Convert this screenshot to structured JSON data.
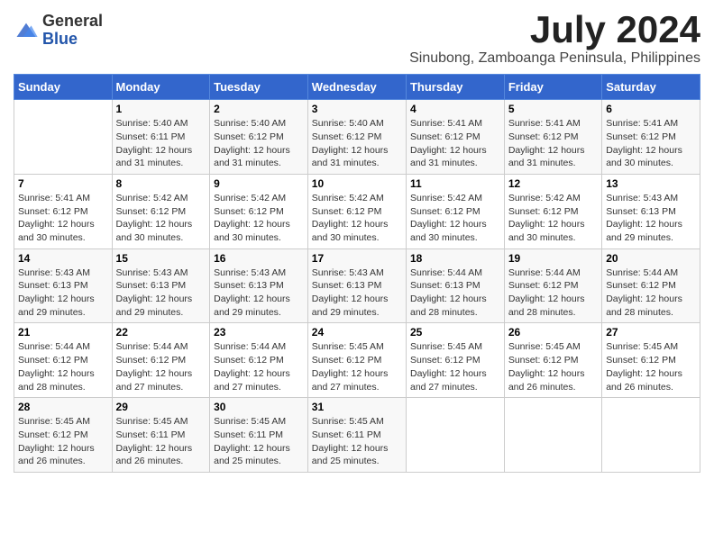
{
  "header": {
    "logo_general": "General",
    "logo_blue": "Blue",
    "month_title": "July 2024",
    "location": "Sinubong, Zamboanga Peninsula, Philippines"
  },
  "days_of_week": [
    "Sunday",
    "Monday",
    "Tuesday",
    "Wednesday",
    "Thursday",
    "Friday",
    "Saturday"
  ],
  "weeks": [
    [
      {
        "day": "",
        "sunrise": "",
        "sunset": "",
        "daylight": ""
      },
      {
        "day": "1",
        "sunrise": "Sunrise: 5:40 AM",
        "sunset": "Sunset: 6:11 PM",
        "daylight": "Daylight: 12 hours and 31 minutes."
      },
      {
        "day": "2",
        "sunrise": "Sunrise: 5:40 AM",
        "sunset": "Sunset: 6:12 PM",
        "daylight": "Daylight: 12 hours and 31 minutes."
      },
      {
        "day": "3",
        "sunrise": "Sunrise: 5:40 AM",
        "sunset": "Sunset: 6:12 PM",
        "daylight": "Daylight: 12 hours and 31 minutes."
      },
      {
        "day": "4",
        "sunrise": "Sunrise: 5:41 AM",
        "sunset": "Sunset: 6:12 PM",
        "daylight": "Daylight: 12 hours and 31 minutes."
      },
      {
        "day": "5",
        "sunrise": "Sunrise: 5:41 AM",
        "sunset": "Sunset: 6:12 PM",
        "daylight": "Daylight: 12 hours and 31 minutes."
      },
      {
        "day": "6",
        "sunrise": "Sunrise: 5:41 AM",
        "sunset": "Sunset: 6:12 PM",
        "daylight": "Daylight: 12 hours and 30 minutes."
      }
    ],
    [
      {
        "day": "7",
        "sunrise": "Sunrise: 5:41 AM",
        "sunset": "Sunset: 6:12 PM",
        "daylight": "Daylight: 12 hours and 30 minutes."
      },
      {
        "day": "8",
        "sunrise": "Sunrise: 5:42 AM",
        "sunset": "Sunset: 6:12 PM",
        "daylight": "Daylight: 12 hours and 30 minutes."
      },
      {
        "day": "9",
        "sunrise": "Sunrise: 5:42 AM",
        "sunset": "Sunset: 6:12 PM",
        "daylight": "Daylight: 12 hours and 30 minutes."
      },
      {
        "day": "10",
        "sunrise": "Sunrise: 5:42 AM",
        "sunset": "Sunset: 6:12 PM",
        "daylight": "Daylight: 12 hours and 30 minutes."
      },
      {
        "day": "11",
        "sunrise": "Sunrise: 5:42 AM",
        "sunset": "Sunset: 6:12 PM",
        "daylight": "Daylight: 12 hours and 30 minutes."
      },
      {
        "day": "12",
        "sunrise": "Sunrise: 5:42 AM",
        "sunset": "Sunset: 6:12 PM",
        "daylight": "Daylight: 12 hours and 30 minutes."
      },
      {
        "day": "13",
        "sunrise": "Sunrise: 5:43 AM",
        "sunset": "Sunset: 6:13 PM",
        "daylight": "Daylight: 12 hours and 29 minutes."
      }
    ],
    [
      {
        "day": "14",
        "sunrise": "Sunrise: 5:43 AM",
        "sunset": "Sunset: 6:13 PM",
        "daylight": "Daylight: 12 hours and 29 minutes."
      },
      {
        "day": "15",
        "sunrise": "Sunrise: 5:43 AM",
        "sunset": "Sunset: 6:13 PM",
        "daylight": "Daylight: 12 hours and 29 minutes."
      },
      {
        "day": "16",
        "sunrise": "Sunrise: 5:43 AM",
        "sunset": "Sunset: 6:13 PM",
        "daylight": "Daylight: 12 hours and 29 minutes."
      },
      {
        "day": "17",
        "sunrise": "Sunrise: 5:43 AM",
        "sunset": "Sunset: 6:13 PM",
        "daylight": "Daylight: 12 hours and 29 minutes."
      },
      {
        "day": "18",
        "sunrise": "Sunrise: 5:44 AM",
        "sunset": "Sunset: 6:13 PM",
        "daylight": "Daylight: 12 hours and 28 minutes."
      },
      {
        "day": "19",
        "sunrise": "Sunrise: 5:44 AM",
        "sunset": "Sunset: 6:12 PM",
        "daylight": "Daylight: 12 hours and 28 minutes."
      },
      {
        "day": "20",
        "sunrise": "Sunrise: 5:44 AM",
        "sunset": "Sunset: 6:12 PM",
        "daylight": "Daylight: 12 hours and 28 minutes."
      }
    ],
    [
      {
        "day": "21",
        "sunrise": "Sunrise: 5:44 AM",
        "sunset": "Sunset: 6:12 PM",
        "daylight": "Daylight: 12 hours and 28 minutes."
      },
      {
        "day": "22",
        "sunrise": "Sunrise: 5:44 AM",
        "sunset": "Sunset: 6:12 PM",
        "daylight": "Daylight: 12 hours and 27 minutes."
      },
      {
        "day": "23",
        "sunrise": "Sunrise: 5:44 AM",
        "sunset": "Sunset: 6:12 PM",
        "daylight": "Daylight: 12 hours and 27 minutes."
      },
      {
        "day": "24",
        "sunrise": "Sunrise: 5:45 AM",
        "sunset": "Sunset: 6:12 PM",
        "daylight": "Daylight: 12 hours and 27 minutes."
      },
      {
        "day": "25",
        "sunrise": "Sunrise: 5:45 AM",
        "sunset": "Sunset: 6:12 PM",
        "daylight": "Daylight: 12 hours and 27 minutes."
      },
      {
        "day": "26",
        "sunrise": "Sunrise: 5:45 AM",
        "sunset": "Sunset: 6:12 PM",
        "daylight": "Daylight: 12 hours and 26 minutes."
      },
      {
        "day": "27",
        "sunrise": "Sunrise: 5:45 AM",
        "sunset": "Sunset: 6:12 PM",
        "daylight": "Daylight: 12 hours and 26 minutes."
      }
    ],
    [
      {
        "day": "28",
        "sunrise": "Sunrise: 5:45 AM",
        "sunset": "Sunset: 6:12 PM",
        "daylight": "Daylight: 12 hours and 26 minutes."
      },
      {
        "day": "29",
        "sunrise": "Sunrise: 5:45 AM",
        "sunset": "Sunset: 6:11 PM",
        "daylight": "Daylight: 12 hours and 26 minutes."
      },
      {
        "day": "30",
        "sunrise": "Sunrise: 5:45 AM",
        "sunset": "Sunset: 6:11 PM",
        "daylight": "Daylight: 12 hours and 25 minutes."
      },
      {
        "day": "31",
        "sunrise": "Sunrise: 5:45 AM",
        "sunset": "Sunset: 6:11 PM",
        "daylight": "Daylight: 12 hours and 25 minutes."
      },
      {
        "day": "",
        "sunrise": "",
        "sunset": "",
        "daylight": ""
      },
      {
        "day": "",
        "sunrise": "",
        "sunset": "",
        "daylight": ""
      },
      {
        "day": "",
        "sunrise": "",
        "sunset": "",
        "daylight": ""
      }
    ]
  ]
}
